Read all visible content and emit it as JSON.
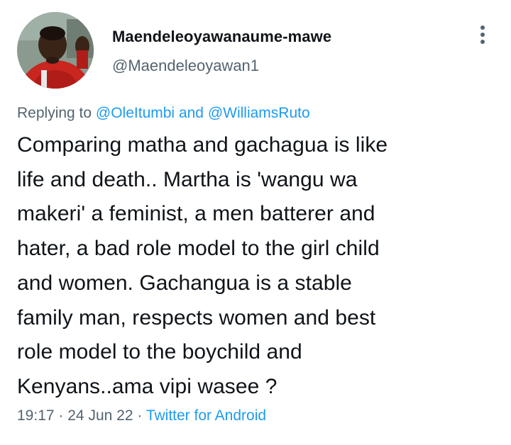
{
  "tweet": {
    "author": {
      "display_name": "Maendeleoyawanaume-mawe",
      "handle": "@Maendeleoyawan1"
    },
    "replying_prefix": "Replying to",
    "replying_to": [
      "@OleItumbi",
      "@WilliamsRuto"
    ],
    "replying_joiner": "and",
    "text": "Comparing matha and gachagua is like\nlife and death.. Martha is 'wangu wa\nmakeri' a feminist, a men batterer and\nhater, a bad role model to the girl child\nand women. Gachangua is a stable\nfamily man, respects women and best\nrole model to the boychild and\nKenyans..ama vipi wasee ?",
    "time": "19:17",
    "date": "24 Jun 22",
    "separator": "·",
    "source": "Twitter for Android"
  },
  "icons": {
    "more": "more-vertical-icon",
    "avatar": "user-avatar"
  },
  "colors": {
    "link": "#1d9bf0",
    "secondary_text": "#536471",
    "primary_text": "#0f1419"
  }
}
